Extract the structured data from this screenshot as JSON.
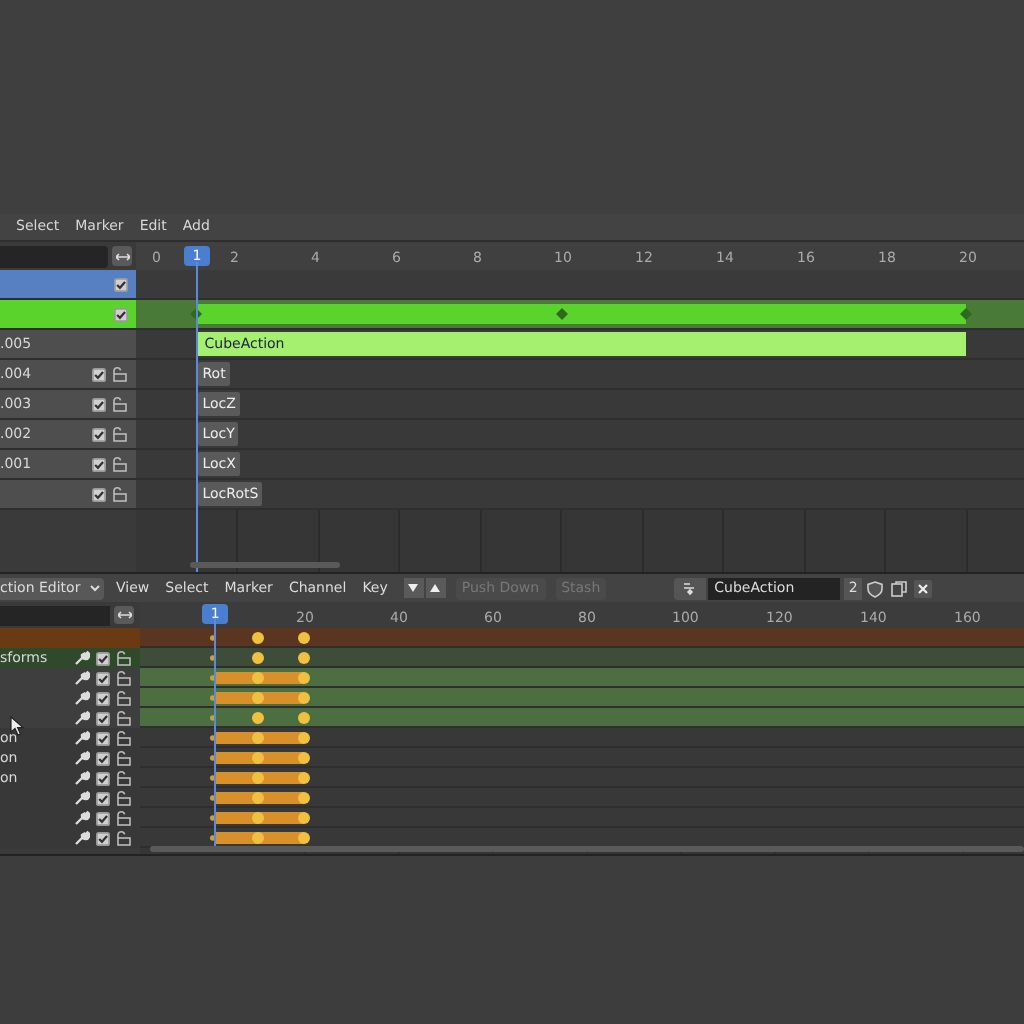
{
  "nla": {
    "menu": [
      "Select",
      "Marker",
      "Edit",
      "Add"
    ],
    "ruler": {
      "start": "0",
      "current": "1",
      "ticks": [
        "2",
        "4",
        "6",
        "8",
        "10",
        "12",
        "14",
        "16",
        "18",
        "20"
      ]
    },
    "tracks": [
      {
        "kind": "object",
        "checked": true
      },
      {
        "kind": "action",
        "checked": true
      },
      {
        "kind": "track",
        "name": ".005",
        "strip": {
          "kind": "action",
          "label": "CubeAction"
        }
      },
      {
        "kind": "track",
        "name": ".004",
        "checked": true,
        "locked": false,
        "strip": {
          "kind": "clip",
          "label": "Rot"
        }
      },
      {
        "kind": "track",
        "name": ".003",
        "checked": true,
        "locked": false,
        "strip": {
          "kind": "clip",
          "label": "LocZ"
        }
      },
      {
        "kind": "track",
        "name": ".002",
        "checked": true,
        "locked": false,
        "strip": {
          "kind": "clip",
          "label": "LocY"
        }
      },
      {
        "kind": "track",
        "name": ".001",
        "checked": true,
        "locked": false,
        "strip": {
          "kind": "clip",
          "label": "LocX"
        }
      },
      {
        "kind": "track",
        "checked": true,
        "locked": false,
        "strip": {
          "kind": "clip",
          "label": "LocRotS"
        }
      }
    ]
  },
  "action_editor": {
    "mode": "ction Editor",
    "menu": [
      "View",
      "Select",
      "Marker",
      "Channel",
      "Key"
    ],
    "push_down": {
      "label": "Push Down",
      "disabled": true
    },
    "stash": {
      "label": "Stash",
      "disabled": true
    },
    "action": {
      "value": "CubeAction",
      "users": "2"
    },
    "ruler": {
      "current": "1",
      "ticks": [
        "20",
        "40",
        "60",
        "80",
        "100",
        "120",
        "140",
        "160"
      ]
    },
    "channels": [
      {
        "kind": "summary",
        "hold": false
      },
      {
        "kind": "group",
        "name": "sforms",
        "checked": true,
        "locked": false,
        "hold": false
      },
      {
        "kind": "channel",
        "selected": true,
        "checked": true,
        "locked": false,
        "hold": true
      },
      {
        "kind": "channel",
        "selected": true,
        "checked": true,
        "locked": false,
        "hold": true
      },
      {
        "kind": "channel",
        "selected": true,
        "checked": true,
        "locked": false,
        "hold": false
      },
      {
        "kind": "channel",
        "name": "on",
        "selected": false,
        "checked": true,
        "locked": false,
        "hold": true
      },
      {
        "kind": "channel",
        "name": "on",
        "selected": false,
        "checked": true,
        "locked": false,
        "hold": true
      },
      {
        "kind": "channel",
        "name": "on",
        "selected": false,
        "checked": true,
        "locked": false,
        "hold": true
      },
      {
        "kind": "channel",
        "selected": false,
        "checked": true,
        "locked": false,
        "hold": true
      },
      {
        "kind": "channel",
        "selected": false,
        "checked": true,
        "locked": false,
        "hold": true
      },
      {
        "kind": "channel",
        "selected": false,
        "checked": true,
        "locked": false,
        "hold": true
      }
    ]
  }
}
